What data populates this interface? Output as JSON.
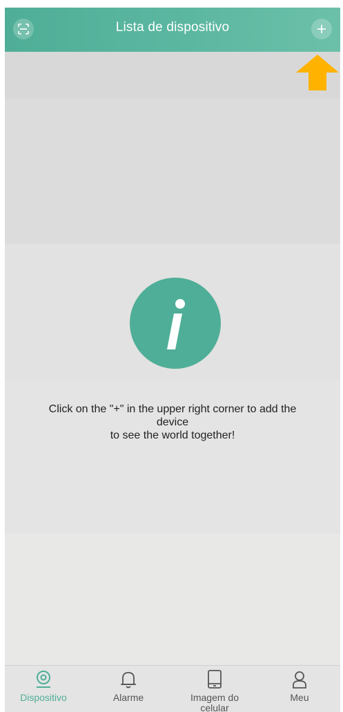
{
  "header": {
    "title": "Lista de dispositivo",
    "scan_icon": "scan-icon",
    "add_icon": "plus-icon",
    "color": "#5cb7a1"
  },
  "hint_arrow": {
    "icon": "arrow-up-icon",
    "color": "#ffb300"
  },
  "empty_state": {
    "icon": "info-icon",
    "icon_color": "#4fae97",
    "line1": "Click on the \"+\" in the upper right corner to add the",
    "line2": "device",
    "line3": "to see the world together!"
  },
  "tabbar": {
    "tabs": [
      {
        "label": "Dispositivo",
        "icon": "camera-icon",
        "active": true
      },
      {
        "label": "Alarme",
        "icon": "bell-icon",
        "active": false
      },
      {
        "label": "Imagem do celular",
        "icon": "phone-icon",
        "active": false
      },
      {
        "label": "Meu",
        "icon": "user-icon",
        "active": false
      }
    ],
    "active_color": "#4fae97",
    "inactive_color": "#555555"
  }
}
